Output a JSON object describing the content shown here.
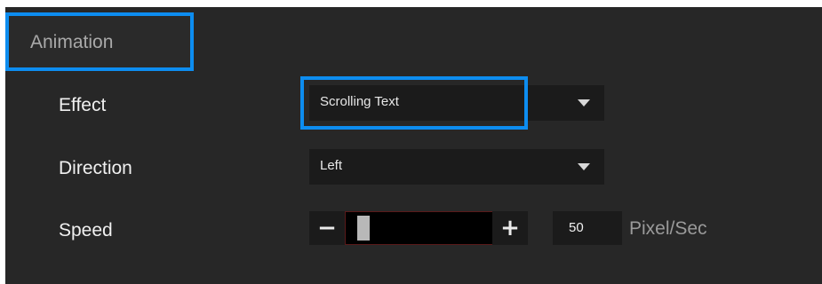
{
  "section": {
    "tab_label": "Animation"
  },
  "effect": {
    "label": "Effect",
    "value": "Scrolling Text"
  },
  "direction": {
    "label": "Direction",
    "value": "Left"
  },
  "speed": {
    "label": "Speed",
    "decrement_symbol": "−",
    "increment_symbol": "+",
    "slider_fraction": 0.05,
    "value": "50",
    "unit": "Pixel/Sec"
  },
  "colors": {
    "panel_bg": "#272727",
    "control_bg": "#1b1b1b",
    "highlight": "#0d8df0"
  }
}
